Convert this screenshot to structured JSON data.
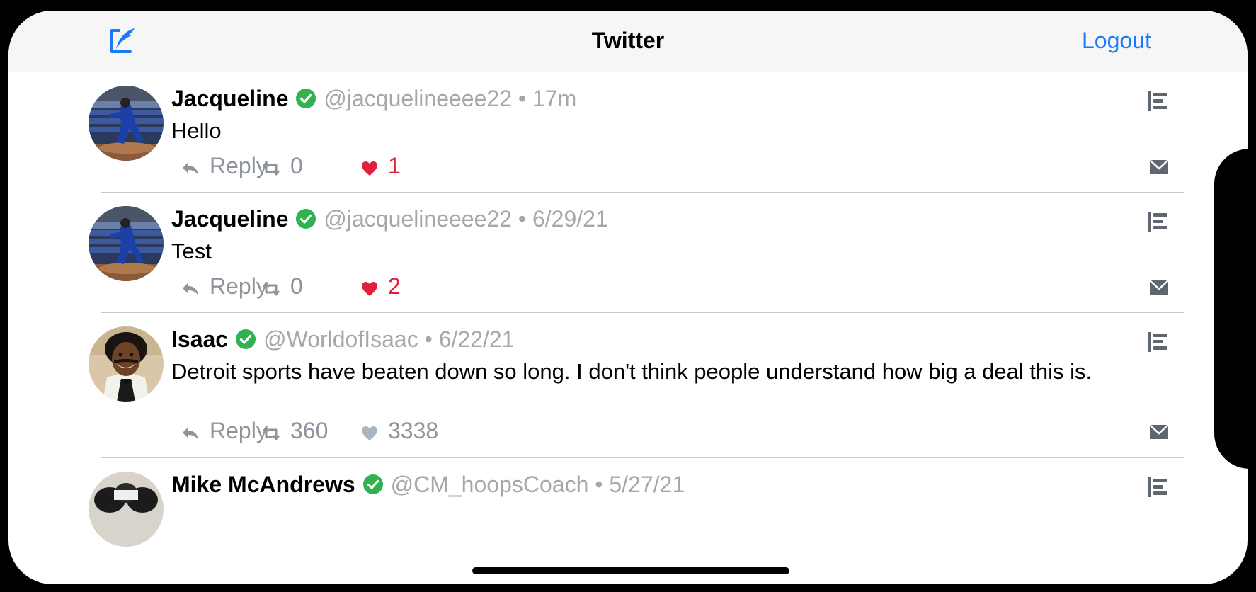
{
  "navbar": {
    "title": "Twitter",
    "logout_label": "Logout",
    "compose_icon": "compose-feather-icon"
  },
  "colors": {
    "accent": "#1a7af8",
    "verified": "#2fb24f",
    "liked": "#e0203c",
    "muted": "#a4a8ad"
  },
  "tweets": [
    {
      "name": "Jacqueline",
      "verified": true,
      "handle": "@jacquelineeee22",
      "separator": "•",
      "time": "17m",
      "text": "Hello",
      "reply_label": "Reply",
      "retweets": "0",
      "likes": "1",
      "liked": true
    },
    {
      "name": "Jacqueline",
      "verified": true,
      "handle": "@jacquelineeee22",
      "separator": "•",
      "time": "6/29/21",
      "text": "Test",
      "reply_label": "Reply",
      "retweets": "0",
      "likes": "2",
      "liked": true
    },
    {
      "name": "Isaac",
      "verified": true,
      "handle": "@WorldofIsaac",
      "separator": "•",
      "time": "6/22/21",
      "text": "Detroit sports have beaten down so long. I don't think people understand how big a deal this is.",
      "reply_label": "Reply",
      "retweets": "360",
      "likes": "3338",
      "liked": false
    },
    {
      "name": "Mike McAndrews",
      "verified": true,
      "handle": "@CM_hoopsCoach",
      "separator": "•",
      "time": "5/27/21"
    }
  ]
}
